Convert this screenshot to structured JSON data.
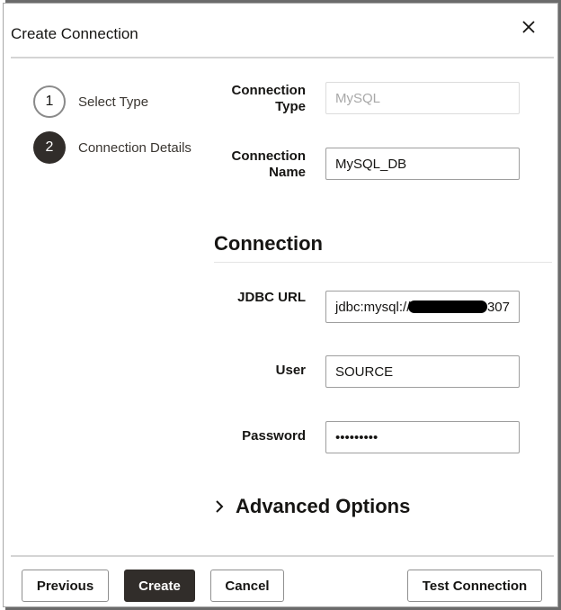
{
  "dialog": {
    "title": "Create Connection",
    "close_icon": "close-icon"
  },
  "stepper": [
    {
      "number": "1",
      "label": "Select Type",
      "state": "completed"
    },
    {
      "number": "2",
      "label": "Connection Details",
      "state": "current"
    }
  ],
  "form": {
    "connection_type": {
      "label_line1": "Connection",
      "label_line2": "Type",
      "value": "MySQL"
    },
    "connection_name": {
      "label_line1": "Connection",
      "label_line2": "Name",
      "value": "MySQL_DB"
    },
    "section_title": "Connection",
    "jdbc_url": {
      "label": "JDBC URL",
      "value_prefix": "jdbc:mysql://",
      "value_suffix": "3307"
    },
    "user": {
      "label": "User",
      "value": "SOURCE"
    },
    "password": {
      "label": "Password",
      "value": "•••••••••"
    },
    "advanced": {
      "label": "Advanced Options",
      "icon": "chevron-right-icon"
    }
  },
  "footer": {
    "previous_label": "Previous",
    "create_label": "Create",
    "cancel_label": "Cancel",
    "test_label": "Test Connection"
  },
  "colors": {
    "primary_button": "#312d2a",
    "text": "#161513",
    "border": "#9e9e9e"
  }
}
